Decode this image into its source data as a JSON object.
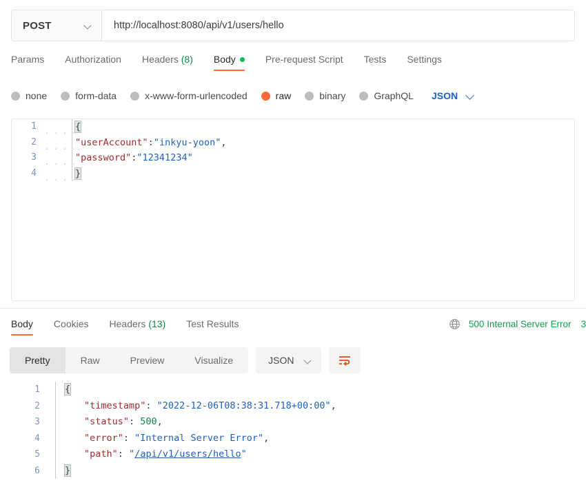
{
  "request": {
    "method": "POST",
    "url": "http://localhost:8080/api/v1/users/hello",
    "tabs": [
      {
        "label": "Params",
        "active": false
      },
      {
        "label": "Authorization",
        "active": false
      },
      {
        "label": "Headers",
        "count": "(8)",
        "active": false
      },
      {
        "label": "Body",
        "active": true,
        "dot": true
      },
      {
        "label": "Pre-request Script",
        "active": false
      },
      {
        "label": "Tests",
        "active": false
      },
      {
        "label": "Settings",
        "active": false
      }
    ],
    "body_types": [
      {
        "label": "none",
        "selected": false
      },
      {
        "label": "form-data",
        "selected": false
      },
      {
        "label": "x-www-form-urlencoded",
        "selected": false
      },
      {
        "label": "raw",
        "selected": true
      },
      {
        "label": "binary",
        "selected": false
      },
      {
        "label": "GraphQL",
        "selected": false
      }
    ],
    "format": "JSON",
    "body_lines": [
      {
        "n": "1",
        "open_brace": "{"
      },
      {
        "n": "2",
        "key": "\"userAccount\"",
        "colon": ":",
        "value": "\"inkyu-yoon\"",
        "comma": ","
      },
      {
        "n": "3",
        "key": "\"password\"",
        "colon": ":",
        "value": "\"12341234\""
      },
      {
        "n": "4",
        "close_brace": "}"
      }
    ]
  },
  "response": {
    "tabs": [
      {
        "label": "Body",
        "active": true
      },
      {
        "label": "Cookies",
        "active": false
      },
      {
        "label": "Headers",
        "count": "(13)",
        "active": false
      },
      {
        "label": "Test Results",
        "active": false
      }
    ],
    "status": "500 Internal Server Error",
    "time": "3",
    "view_modes": [
      {
        "label": "Pretty",
        "active": true
      },
      {
        "label": "Raw",
        "active": false
      },
      {
        "label": "Preview",
        "active": false
      },
      {
        "label": "Visualize",
        "active": false
      }
    ],
    "format": "JSON",
    "body_lines": [
      {
        "n": "1",
        "open_brace": "{"
      },
      {
        "n": "2",
        "key": "\"timestamp\"",
        "colon": ": ",
        "value": "\"2022-12-06T08:38:31.718+00:00\"",
        "comma": ","
      },
      {
        "n": "3",
        "key": "\"status\"",
        "colon": ": ",
        "num": "500",
        "comma": ","
      },
      {
        "n": "4",
        "key": "\"error\"",
        "colon": ": ",
        "value": "\"Internal Server Error\"",
        "comma": ","
      },
      {
        "n": "5",
        "key": "\"path\"",
        "colon": ": ",
        "link": "/api/v1/users/hello"
      },
      {
        "n": "6",
        "close_brace": "}"
      }
    ]
  },
  "colors": {
    "accent": "#ff6c37",
    "success": "#0f9e52",
    "link": "#1a5fd6",
    "json_key": "#9e2c2c",
    "json_string": "#1f5fbf",
    "json_number": "#0b8a4b"
  },
  "icons": {
    "method_chevron": "chevron-down-icon",
    "format_chevron": "chevron-down-icon",
    "globe": "globe-icon",
    "word_wrap": "word-wrap-icon"
  }
}
